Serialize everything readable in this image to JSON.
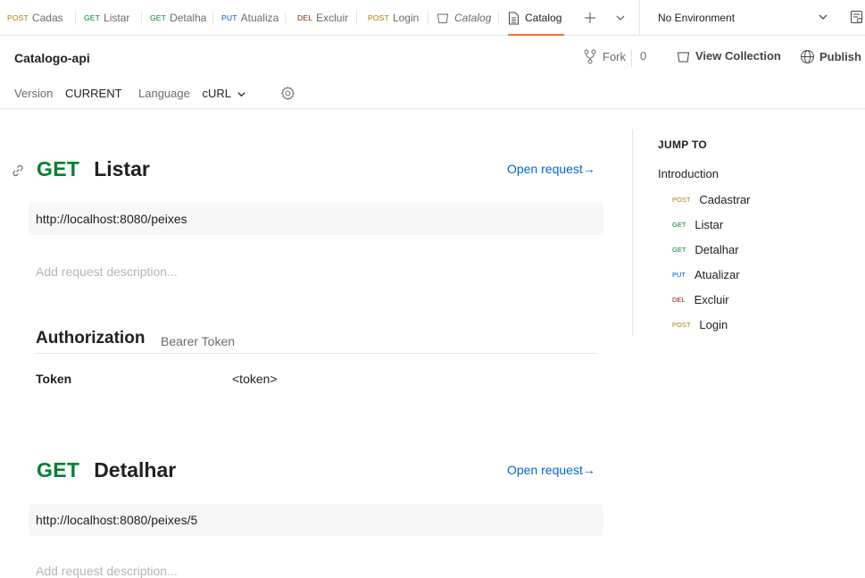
{
  "tabs": [
    {
      "method": "POST",
      "method_class": "post",
      "label": "Cadas"
    },
    {
      "method": "GET",
      "method_class": "get",
      "label": "Listar"
    },
    {
      "method": "GET",
      "method_class": "get",
      "label": "Detalha"
    },
    {
      "method": "PUT",
      "method_class": "put",
      "label": "Atualiza"
    },
    {
      "method": "DEL",
      "method_class": "del",
      "label": "Excluir"
    },
    {
      "method": "POST",
      "method_class": "post",
      "label": "Login"
    },
    {
      "icon": "collection-icon",
      "label": "Catalog"
    },
    {
      "icon": "document-icon",
      "label": "Catalog",
      "active": true
    }
  ],
  "environment": {
    "label": "No Environment"
  },
  "header": {
    "title": "Catalogo-api",
    "fork_label": "Fork",
    "fork_count": "0",
    "view_collection_label": "View Collection",
    "publish_label": "Publish",
    "version_label": "Version",
    "version_value": "CURRENT",
    "language_label": "Language",
    "language_value": "cURL"
  },
  "requests": [
    {
      "verb": "GET",
      "name": "Listar",
      "open_label": "Open request→",
      "url": "http://localhost:8080/peixes",
      "description_placeholder": "Add request description...",
      "auth_title": "Authorization",
      "auth_type": "Bearer Token",
      "token_key": "Token",
      "token_value": "<token>"
    },
    {
      "verb": "GET",
      "name": "Detalhar",
      "open_label": "Open request→",
      "url": "http://localhost:8080/peixes/5",
      "description_placeholder": "Add request description..."
    }
  ],
  "jump_to": {
    "title": "JUMP TO",
    "intro": "Introduction",
    "items": [
      {
        "method": "POST",
        "method_class": "post",
        "label": "Cadastrar"
      },
      {
        "method": "GET",
        "method_class": "get",
        "label": "Listar"
      },
      {
        "method": "GET",
        "method_class": "get",
        "label": "Detalhar"
      },
      {
        "method": "PUT",
        "method_class": "put",
        "label": "Atualizar"
      },
      {
        "method": "DEL",
        "method_class": "del",
        "label": "Excluir"
      },
      {
        "method": "POST",
        "method_class": "post",
        "label": "Login"
      }
    ]
  },
  "colors": {
    "accent": "#ff6c37",
    "link": "#0265d2",
    "get": "#007f31",
    "post": "#ad7a03",
    "put": "#0053b8",
    "del": "#8e1a10"
  }
}
